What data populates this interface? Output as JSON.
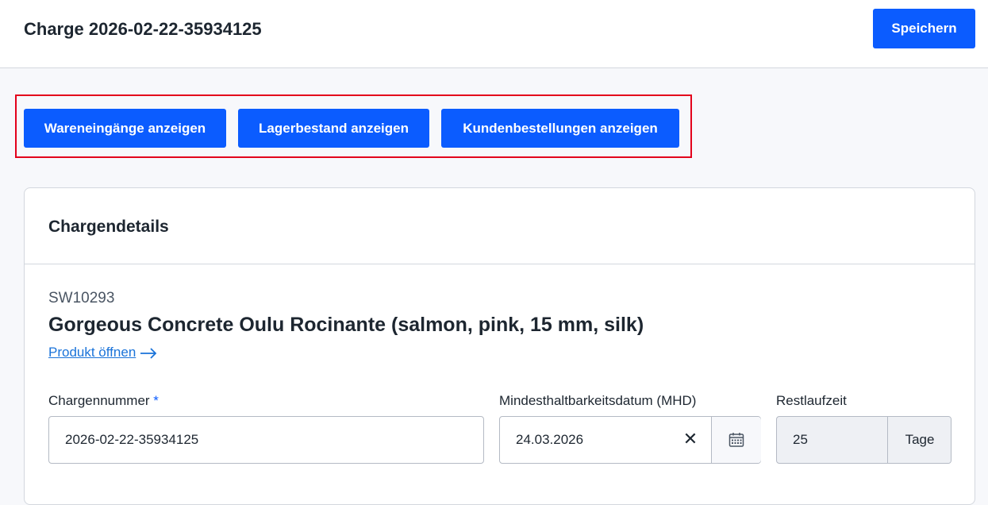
{
  "header": {
    "title": "Charge 2026-02-22-35934125",
    "save_label": "Speichern"
  },
  "actions": {
    "goods_receipts": "Wareneingänge anzeigen",
    "stock": "Lagerbestand anzeigen",
    "customer_orders": "Kundenbestellungen anzeigen"
  },
  "details": {
    "title": "Chargendetails",
    "sku": "SW10293",
    "product_name": "Gorgeous Concrete Oulu Rocinante (salmon, pink, 15 mm, silk)",
    "product_link": "Produkt öffnen",
    "batch_number_label": "Chargennummer",
    "required_marker": "*",
    "batch_number_value": "2026-02-22-35934125",
    "best_before_label": "Mindesthaltbarkeitsdatum (MHD)",
    "best_before_value": "24.03.2026",
    "remaining_label": "Restlaufzeit",
    "remaining_value": "25",
    "remaining_unit": "Tage"
  },
  "colors": {
    "primary": "#0b5cff",
    "highlight_border": "#e3001b",
    "link": "#1a73d9"
  }
}
